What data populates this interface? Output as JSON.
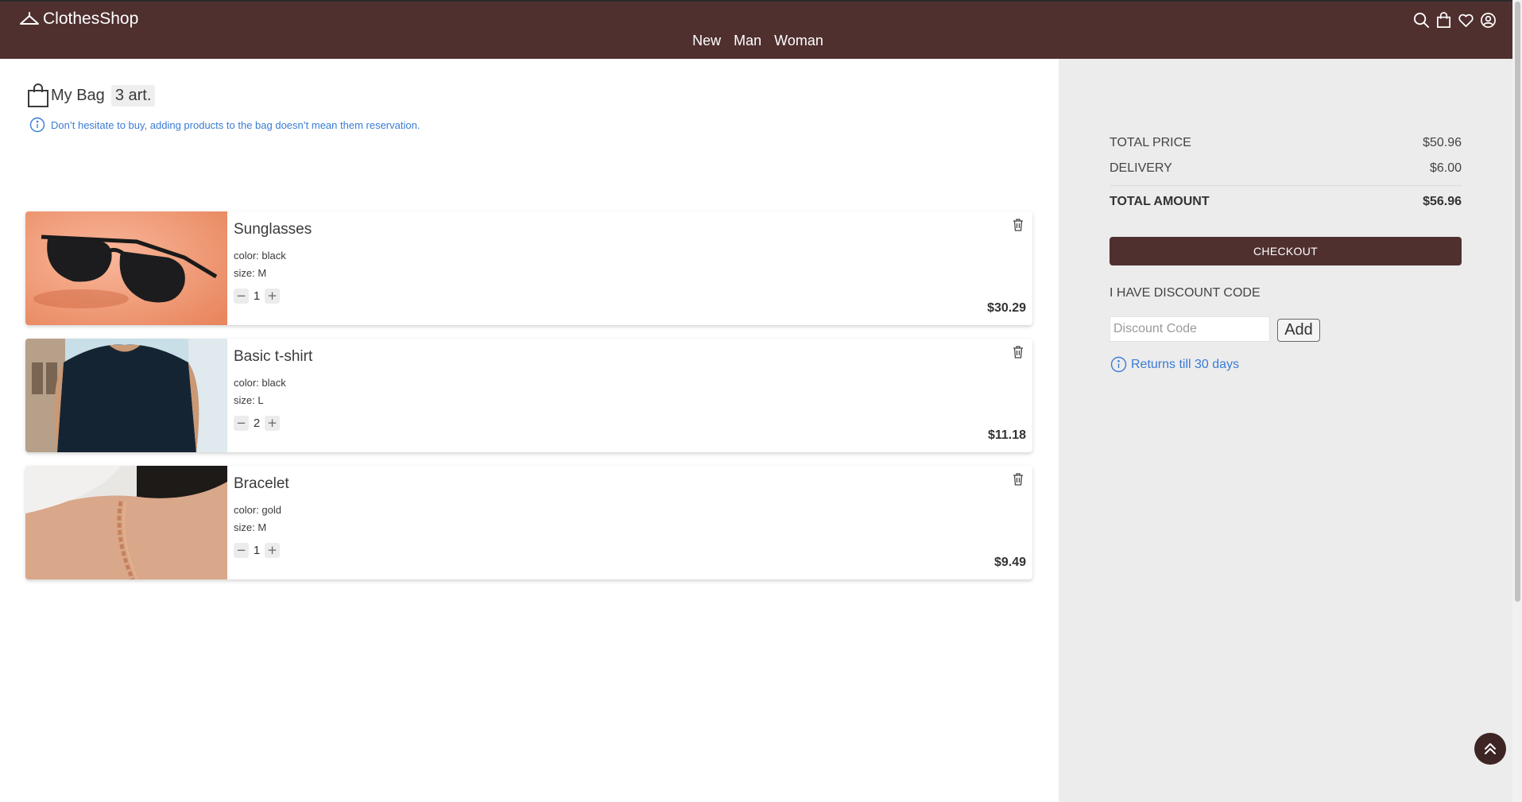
{
  "header": {
    "logo": "ClothesShop",
    "nav": [
      "New",
      "Man",
      "Woman"
    ],
    "icons": [
      "search-icon",
      "bag-icon",
      "heart-icon",
      "user-icon"
    ],
    "background": "#4f302f"
  },
  "bag": {
    "title": "My Bag",
    "count": "3 art.",
    "info": "Don’t hesitate to buy, adding products to the bag doesn’t mean them reservation.",
    "items": [
      {
        "name": "Sunglasses",
        "color_label": "color: black",
        "size_label": "size: M",
        "qty": "1",
        "price": "$30.29"
      },
      {
        "name": "Basic t-shirt",
        "color_label": "color: black",
        "size_label": "size: L",
        "qty": "2",
        "price": "$11.18"
      },
      {
        "name": "Bracelet",
        "color_label": "color: gold",
        "size_label": "size: M",
        "qty": "1",
        "price": "$9.49"
      }
    ]
  },
  "summary": {
    "total_price_label": "TOTAL PRICE",
    "total_price": "$50.96",
    "delivery_label": "DELIVERY",
    "delivery": "$6.00",
    "total_amount_label": "TOTAL AMOUNT",
    "total_amount": "$56.96",
    "checkout_label": "CHECKOUT",
    "discount_heading": "I HAVE DISCOUNT CODE",
    "discount_placeholder": "Discount Code",
    "add_label": "Add",
    "returns": "Returns till 30 days"
  },
  "colors": {
    "accent": "#4f302f",
    "info_blue": "#3a7bd5",
    "sidebar_bg": "#ececec"
  }
}
